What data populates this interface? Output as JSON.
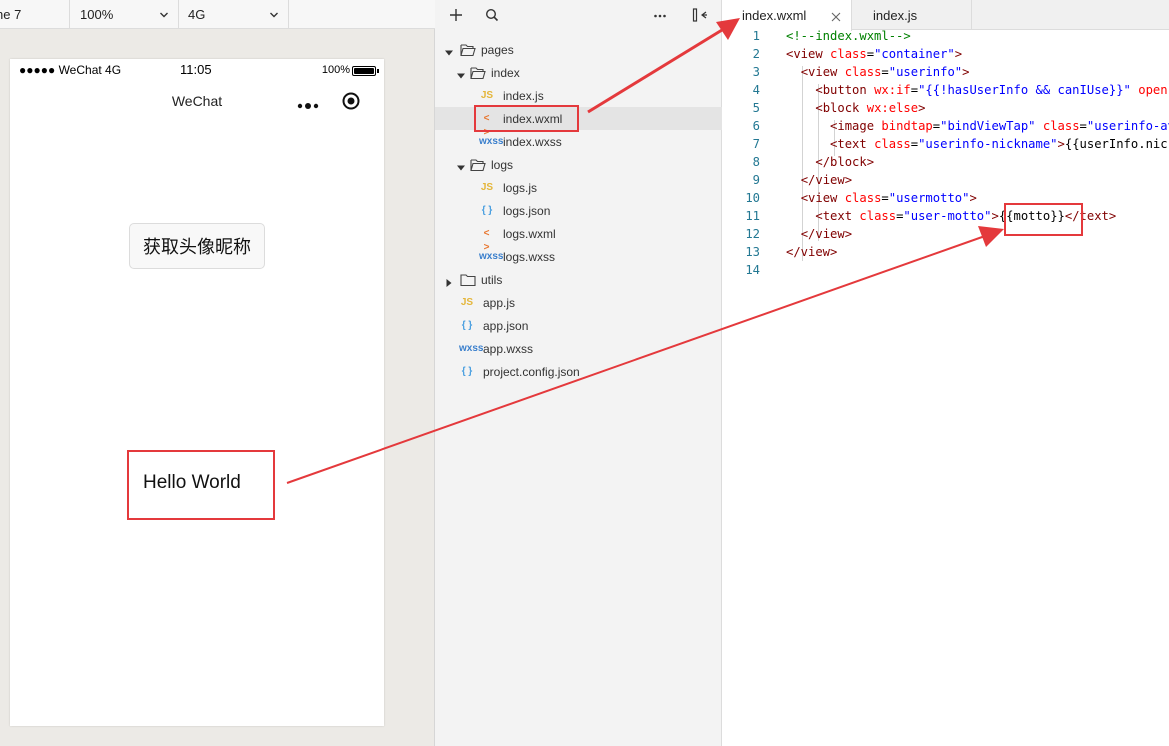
{
  "simulator": {
    "toolbar": {
      "device": "ne 7",
      "zoom": "100%",
      "network": "4G"
    },
    "status_bar": {
      "carrier": "●●●●● WeChat 4G",
      "time": "11:05",
      "battery": "100%"
    },
    "nav": {
      "title": "WeChat",
      "more_icon": "more-dots-icon",
      "capsule_icon": "target-circle-icon"
    },
    "page": {
      "auth_button": "获取头像昵称",
      "motto": "Hello World"
    }
  },
  "explorer": {
    "toolbar_icons": [
      "add-icon",
      "search-icon",
      "more-icon",
      "collapse-panel-icon"
    ],
    "tree": [
      {
        "label": "pages",
        "kind": "folder",
        "expanded": true,
        "depth": 0
      },
      {
        "label": "index",
        "kind": "folder",
        "expanded": true,
        "depth": 1
      },
      {
        "label": "index.js",
        "kind": "file",
        "type": "JS",
        "depth": 2
      },
      {
        "label": "index.wxml",
        "kind": "file",
        "type": "< >",
        "depth": 2,
        "selected": true
      },
      {
        "label": "index.wxss",
        "kind": "file",
        "type": "wxss",
        "depth": 2
      },
      {
        "label": "logs",
        "kind": "folder",
        "expanded": true,
        "depth": 1
      },
      {
        "label": "logs.js",
        "kind": "file",
        "type": "JS",
        "depth": 2
      },
      {
        "label": "logs.json",
        "kind": "file",
        "type": "{ }",
        "depth": 2
      },
      {
        "label": "logs.wxml",
        "kind": "file",
        "type": "< >",
        "depth": 2
      },
      {
        "label": "logs.wxss",
        "kind": "file",
        "type": "wxss",
        "depth": 2
      },
      {
        "label": "utils",
        "kind": "folder",
        "expanded": false,
        "depth": 0
      },
      {
        "label": "app.js",
        "kind": "file",
        "type": "JS",
        "depth": 0
      },
      {
        "label": "app.json",
        "kind": "file",
        "type": "{ }",
        "depth": 0
      },
      {
        "label": "app.wxss",
        "kind": "file",
        "type": "wxss",
        "depth": 0
      },
      {
        "label": "project.config.json",
        "kind": "file",
        "type": "{ }",
        "depth": 0
      }
    ]
  },
  "editor": {
    "tabs": [
      {
        "label": "index.wxml",
        "active": true
      },
      {
        "label": "index.js",
        "active": false
      }
    ],
    "lines": [
      {
        "n": "1",
        "parts": [
          [
            "cmt",
            "<!--index.wxml-->"
          ]
        ]
      },
      {
        "n": "2",
        "parts": [
          [
            "tag",
            "<view "
          ],
          [
            "attr",
            "class"
          ],
          [
            "txt",
            "="
          ],
          [
            "str",
            "\"container\""
          ],
          [
            "tag",
            ">"
          ]
        ]
      },
      {
        "n": "3",
        "parts": [
          [
            "txt",
            "  "
          ],
          [
            "tag",
            "<view "
          ],
          [
            "attr",
            "class"
          ],
          [
            "txt",
            "="
          ],
          [
            "str",
            "\"userinfo\""
          ],
          [
            "tag",
            ">"
          ]
        ]
      },
      {
        "n": "4",
        "parts": [
          [
            "txt",
            "    "
          ],
          [
            "tag",
            "<button "
          ],
          [
            "attr",
            "wx:if"
          ],
          [
            "txt",
            "="
          ],
          [
            "str",
            "\"{{!hasUserInfo && canIUse}}\""
          ],
          [
            "txt",
            " "
          ],
          [
            "attr",
            "open-type"
          ]
        ]
      },
      {
        "n": "5",
        "parts": [
          [
            "txt",
            "    "
          ],
          [
            "tag",
            "<block "
          ],
          [
            "attr",
            "wx:else"
          ],
          [
            "tag",
            ">"
          ]
        ]
      },
      {
        "n": "6",
        "parts": [
          [
            "txt",
            "      "
          ],
          [
            "tag",
            "<image "
          ],
          [
            "attr",
            "bindtap"
          ],
          [
            "txt",
            "="
          ],
          [
            "str",
            "\"bindViewTap\""
          ],
          [
            "txt",
            " "
          ],
          [
            "attr",
            "class"
          ],
          [
            "txt",
            "="
          ],
          [
            "str",
            "\"userinfo-avatar\""
          ]
        ]
      },
      {
        "n": "7",
        "parts": [
          [
            "txt",
            "      "
          ],
          [
            "tag",
            "<text "
          ],
          [
            "attr",
            "class"
          ],
          [
            "txt",
            "="
          ],
          [
            "str",
            "\"userinfo-nickname\""
          ],
          [
            "tag",
            ">"
          ],
          [
            "txt",
            "{{userInfo.nickName}}"
          ]
        ]
      },
      {
        "n": "8",
        "parts": [
          [
            "txt",
            "    "
          ],
          [
            "tag",
            "</block>"
          ]
        ]
      },
      {
        "n": "9",
        "parts": [
          [
            "txt",
            "  "
          ],
          [
            "tag",
            "</view>"
          ]
        ]
      },
      {
        "n": "10",
        "parts": [
          [
            "txt",
            "  "
          ],
          [
            "tag",
            "<view "
          ],
          [
            "attr",
            "class"
          ],
          [
            "txt",
            "="
          ],
          [
            "str",
            "\"usermotto\""
          ],
          [
            "tag",
            ">"
          ]
        ]
      },
      {
        "n": "11",
        "parts": [
          [
            "txt",
            "    "
          ],
          [
            "tag",
            "<text "
          ],
          [
            "attr",
            "class"
          ],
          [
            "txt",
            "="
          ],
          [
            "str",
            "\"user-motto\""
          ],
          [
            "tag",
            ">"
          ],
          [
            "txt",
            "{{motto}}"
          ],
          [
            "tag",
            "</text>"
          ]
        ]
      },
      {
        "n": "12",
        "parts": [
          [
            "txt",
            "  "
          ],
          [
            "tag",
            "</view>"
          ]
        ]
      },
      {
        "n": "13",
        "parts": [
          [
            "tag",
            "</view>"
          ]
        ]
      },
      {
        "n": "14",
        "parts": []
      }
    ]
  },
  "colors": {
    "annotation_red": "#e4393c",
    "selected_row": "#e4e4e4",
    "line_number": "#237893"
  }
}
